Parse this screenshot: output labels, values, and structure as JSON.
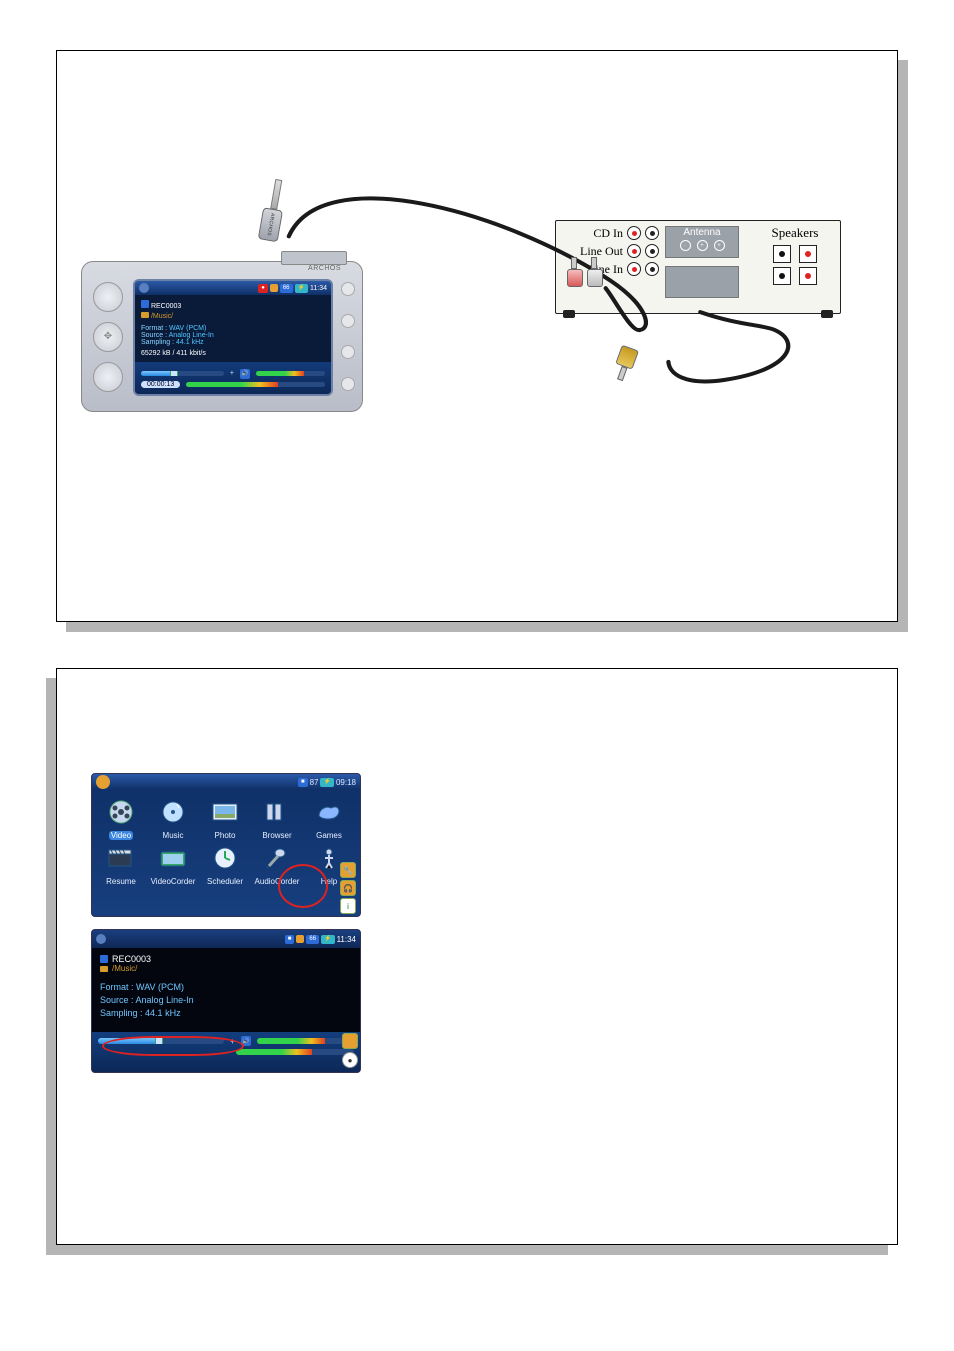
{
  "archos": {
    "brand": "ARCHOS",
    "statusbar": {
      "rec": "●",
      "lock": "🔒",
      "batt": "66",
      "time": "11:34"
    },
    "rec_name_icon": "♪",
    "rec_name": "REC0003",
    "rec_folder_icon": "📁",
    "rec_folder": "/Music/",
    "format_label": "Format :",
    "format_value": "WAV (PCM)",
    "source_label": "Source :",
    "source_value": "Analog Line-In",
    "sampling_label": "Sampling :",
    "sampling_value": "44.1 kHz",
    "size_line": "65292 kB / 411 kbit/s",
    "elapsed": "00:00:13"
  },
  "adapter": {
    "label": "ARCHOS"
  },
  "stereo": {
    "cd_in": "CD In",
    "line_out": "Line Out",
    "line_in": "Line In",
    "antenna": "Antenna",
    "speakers": "Speakers"
  },
  "menu": {
    "statusbar": {
      "stop": "■",
      "vol": "87",
      "time": "09:18"
    },
    "items_row1": [
      {
        "key": "video",
        "label": "Video",
        "selected": true
      },
      {
        "key": "music",
        "label": "Music"
      },
      {
        "key": "photo",
        "label": "Photo"
      },
      {
        "key": "browser",
        "label": "Browser"
      },
      {
        "key": "games",
        "label": "Games"
      }
    ],
    "items_row2": [
      {
        "key": "resume",
        "label": "Resume"
      },
      {
        "key": "videocorder",
        "label": "VideoCorder"
      },
      {
        "key": "scheduler",
        "label": "Scheduler"
      },
      {
        "key": "audiocorder",
        "label": "AudioCorder",
        "circled": true
      },
      {
        "key": "help",
        "label": "Help"
      }
    ]
  },
  "rec": {
    "statusbar": {
      "stop": "■",
      "lock": "🔒",
      "batt": "66",
      "time": "11:34"
    },
    "name_icon": "♪",
    "name": "REC0003",
    "folder_icon": "📁",
    "folder": "/Music/",
    "format_label": "Format :",
    "format_value": "WAV (PCM)",
    "source_label": "Source :",
    "source_value": "Analog Line-In",
    "sampling_label": "Sampling :",
    "sampling_value": "44.1 kHz"
  }
}
